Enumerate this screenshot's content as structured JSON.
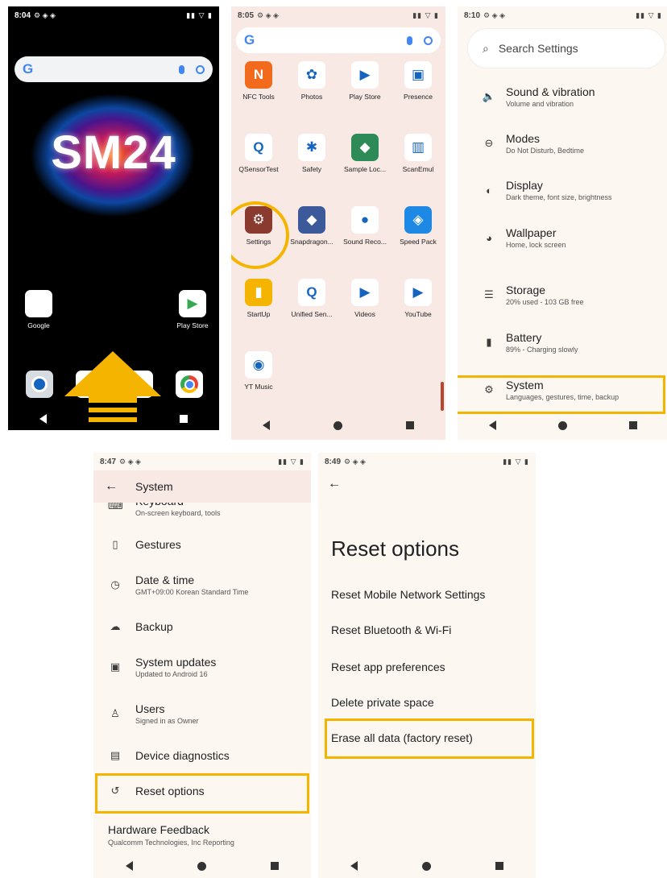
{
  "home": {
    "status_time": "8:04",
    "wallpaper_text": "SM24",
    "search_logo": "G",
    "apps": [
      {
        "label": "Google",
        "icon": "google-folder-icon"
      },
      {
        "label": "Play Store",
        "icon": "play-store-icon"
      }
    ],
    "dock": [
      "camera-icon",
      "messages-icon",
      "phone-icon",
      "chrome-icon"
    ]
  },
  "drawer": {
    "status_time": "8:05",
    "search_logo": "G",
    "apps": [
      {
        "label": "NFC Tools",
        "color": "#f26b1d",
        "glyph": "N"
      },
      {
        "label": "Photos",
        "color": "#ffffff",
        "glyph": "✿"
      },
      {
        "label": "Play Store",
        "color": "#ffffff",
        "glyph": "▶"
      },
      {
        "label": "Presence",
        "color": "#ffffff",
        "glyph": "▣"
      },
      {
        "label": "QSensorTest",
        "color": "#ffffff",
        "glyph": "Q"
      },
      {
        "label": "Safety",
        "color": "#ffffff",
        "glyph": "✱"
      },
      {
        "label": "Sample Loc...",
        "color": "#2e8b57",
        "glyph": "◆"
      },
      {
        "label": "ScanEmul",
        "color": "#ffffff",
        "glyph": "▥"
      },
      {
        "label": "Settings",
        "color": "#8b3a2f",
        "glyph": "⚙"
      },
      {
        "label": "Snapdragon...",
        "color": "#3c5a9a",
        "glyph": "◆"
      },
      {
        "label": "Sound Reco...",
        "color": "#ffffff",
        "glyph": "●"
      },
      {
        "label": "Speed Pack",
        "color": "#1e88e5",
        "glyph": "◈"
      },
      {
        "label": "StartUp",
        "color": "#f5b400",
        "glyph": "▮"
      },
      {
        "label": "Unified Sen...",
        "color": "#ffffff",
        "glyph": "Q"
      },
      {
        "label": "Videos",
        "color": "#ffffff",
        "glyph": "▶"
      },
      {
        "label": "YouTube",
        "color": "#ffffff",
        "glyph": "▶"
      },
      {
        "label": "YT Music",
        "color": "#ffffff",
        "glyph": "◉"
      }
    ]
  },
  "settings": {
    "status_time": "8:10",
    "search_placeholder": "Search Settings",
    "items": [
      {
        "title": "Sound & vibration",
        "subtitle": "Volume and vibration",
        "icon": "speaker-icon",
        "glyph": "🔈"
      },
      {
        "title": "Modes",
        "subtitle": "Do Not Disturb, Bedtime",
        "icon": "modes-icon",
        "glyph": "⊖"
      },
      {
        "title": "Display",
        "subtitle": "Dark theme, font size, brightness",
        "icon": "display-icon",
        "glyph": "◐"
      },
      {
        "title": "Wallpaper",
        "subtitle": "Home, lock screen",
        "icon": "palette-icon",
        "glyph": "◕"
      },
      {
        "title": "Storage",
        "subtitle": "20% used - 103 GB free",
        "icon": "storage-icon",
        "glyph": "☰"
      },
      {
        "title": "Battery",
        "subtitle": "89% - Charging slowly",
        "icon": "battery-icon",
        "glyph": "▮"
      },
      {
        "title": "System",
        "subtitle": "Languages, gestures, time, backup",
        "icon": "gear-icon",
        "glyph": "⚙"
      }
    ]
  },
  "system": {
    "status_time": "8:47",
    "title": "System",
    "items": [
      {
        "title": "Keyboard",
        "subtitle": "On-screen keyboard, tools",
        "glyph": "⌨"
      },
      {
        "title": "Gestures",
        "subtitle": "",
        "glyph": "▯"
      },
      {
        "title": "Date & time",
        "subtitle": "GMT+09:00 Korean Standard Time",
        "glyph": "◷"
      },
      {
        "title": "Backup",
        "subtitle": "",
        "glyph": "☁"
      },
      {
        "title": "System updates",
        "subtitle": "Updated to Android 16",
        "glyph": "▣"
      },
      {
        "title": "Users",
        "subtitle": "Signed in as Owner",
        "glyph": "♙"
      },
      {
        "title": "Device diagnostics",
        "subtitle": "",
        "glyph": "▤"
      },
      {
        "title": "Reset options",
        "subtitle": "",
        "glyph": "↺"
      }
    ],
    "hardware_feedback": {
      "title": "Hardware Feedback",
      "subtitle": "Qualcomm Technologies, Inc Reporting"
    }
  },
  "reset": {
    "status_time": "8:49",
    "title": "Reset options",
    "items": [
      "Reset Mobile Network Settings",
      "Reset Bluetooth & Wi-Fi",
      "Reset app preferences",
      "Delete private space",
      "Erase all data (factory reset)"
    ]
  },
  "colors": {
    "highlight": "#f5b400",
    "panel_bg": "#fdf7f1",
    "drawer_bg": "#f8e9e4"
  }
}
